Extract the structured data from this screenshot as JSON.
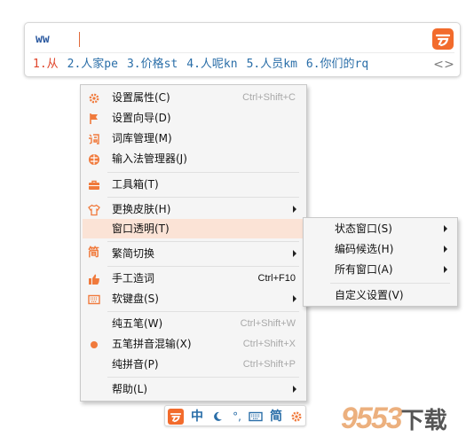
{
  "candidate_window": {
    "composition": "ww",
    "candidates": [
      "1.从",
      "2.人家pe",
      "3.价格st",
      "4.人呢kn",
      "5.人员km",
      "6.你们的rq"
    ],
    "nav_prev": "<",
    "nav_next": ">",
    "brand_color": "#f26b2c",
    "highlight_color": "#e0452b",
    "text_color": "#2a6ea8"
  },
  "menu": {
    "items": [
      {
        "label": "设置属性(C)",
        "shortcut": "Ctrl+Shift+C",
        "icon": "gear-icon"
      },
      {
        "label": "设置向导(D)",
        "shortcut": "",
        "icon": "flag-icon"
      },
      {
        "label": "词库管理(M)",
        "shortcut": "",
        "icon": "dictionary-icon"
      },
      {
        "label": "输入法管理器(J)",
        "shortcut": "",
        "icon": "globe-icon"
      },
      {
        "label": "工具箱(T)",
        "shortcut": "",
        "icon": "toolbox-icon"
      },
      {
        "label": "更换皮肤(H)",
        "shortcut": "",
        "icon": "shirt-icon"
      },
      {
        "label": "窗口透明(T)",
        "shortcut": "",
        "icon": ""
      },
      {
        "label": "繁简切换",
        "shortcut": "",
        "icon": "simplified-char-icon"
      },
      {
        "label": "手工造词",
        "shortcut": "Ctrl+F10",
        "icon": "hand-icon"
      },
      {
        "label": "软键盘(S)",
        "shortcut": "",
        "icon": "soft-keyboard-icon"
      },
      {
        "label": "纯五笔(W)",
        "shortcut": "Ctrl+Shift+W",
        "icon": ""
      },
      {
        "label": "五笔拼音混输(X)",
        "shortcut": "Ctrl+Shift+X",
        "icon": "radio-dot-icon"
      },
      {
        "label": "纯拼音(P)",
        "shortcut": "Ctrl+Shift+P",
        "icon": ""
      },
      {
        "label": "帮助(L)",
        "shortcut": "",
        "icon": ""
      }
    ]
  },
  "submenu": {
    "items": [
      {
        "label": "状态窗口(S)"
      },
      {
        "label": "编码候选(H)"
      },
      {
        "label": "所有窗口(A)"
      },
      {
        "label": "自定义设置(V)"
      }
    ]
  },
  "statusbar": {
    "chinese_mode": "中",
    "simplified": "简",
    "punctuation": "°,"
  },
  "watermark": {
    "number": "9553",
    "suffix": "下载"
  }
}
